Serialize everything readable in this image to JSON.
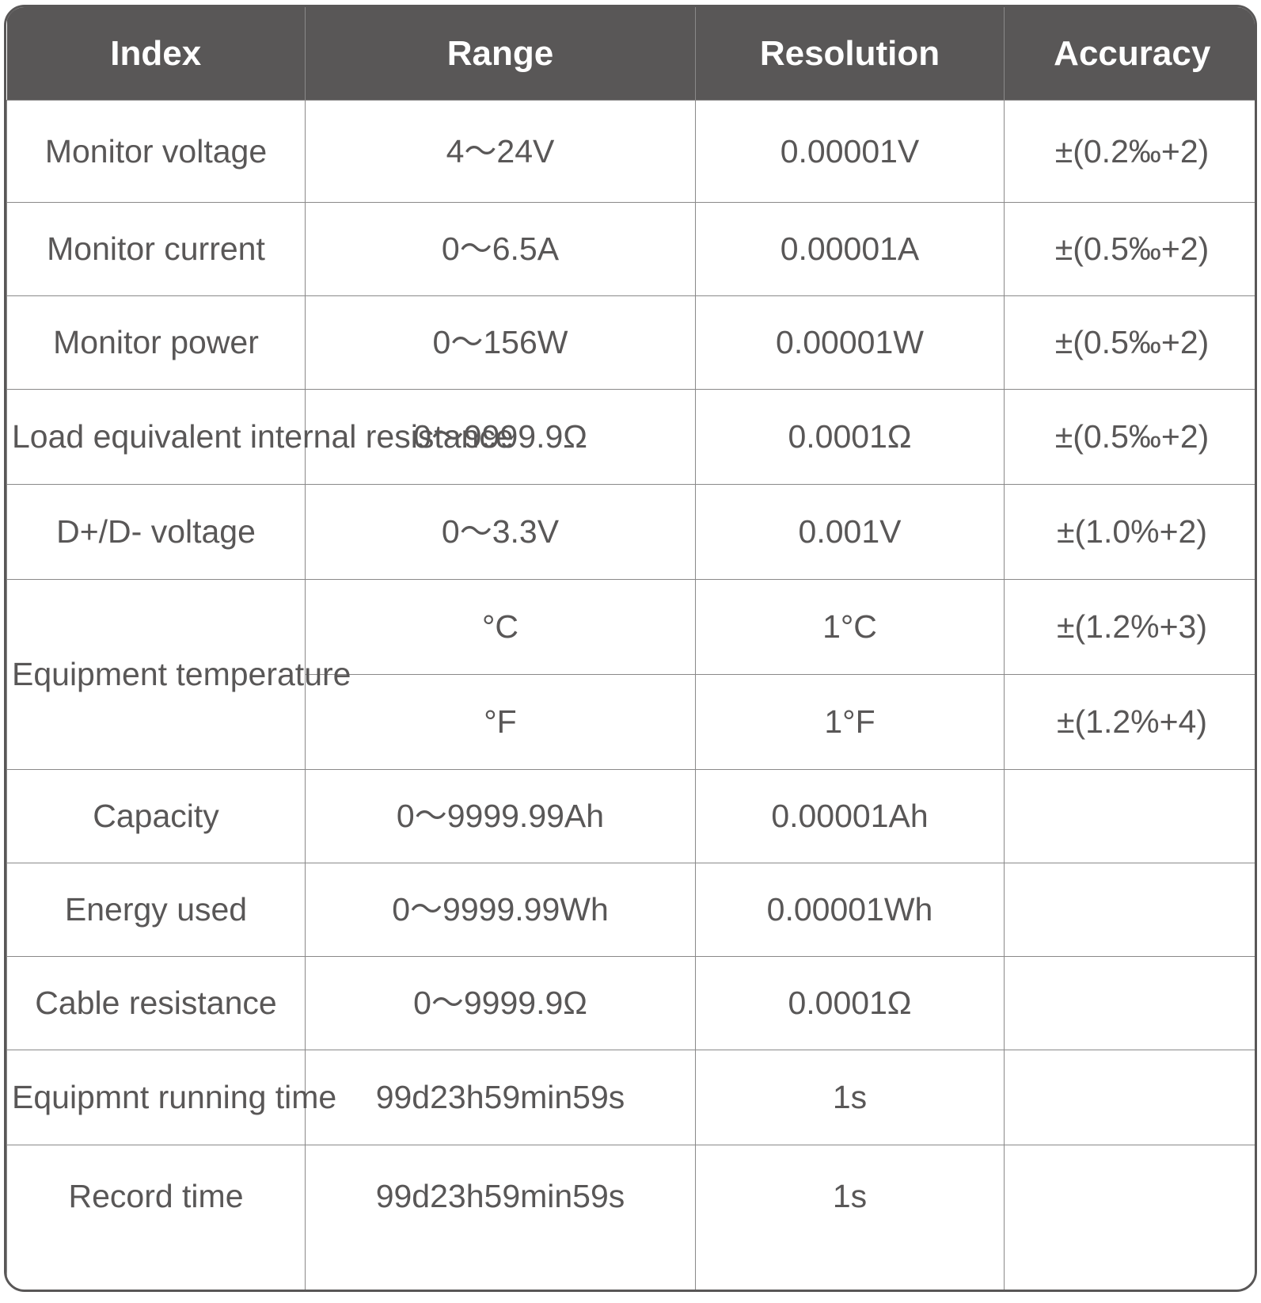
{
  "table": {
    "columns": [
      "Index",
      "Range",
      "Resolution",
      "Accuracy"
    ],
    "rows": [
      {
        "index": "Monitor voltage",
        "range": "4〜24V",
        "resolution": "0.00001V",
        "accuracy": "±(0.2‰+2)"
      },
      {
        "index": "Monitor current",
        "range": "0〜6.5A",
        "resolution": "0.00001A",
        "accuracy": "±(0.5‰+2)"
      },
      {
        "index": "Monitor power",
        "range": "0〜156W",
        "resolution": "0.00001W",
        "accuracy": "±(0.5‰+2)"
      },
      {
        "index": "Load equivalent internal resistance",
        "range": "0〜9999.9Ω",
        "resolution": "0.0001Ω",
        "accuracy": "±(0.5‰+2)"
      },
      {
        "index": "D+/D- voltage",
        "range": "0〜3.3V",
        "resolution": "0.001V",
        "accuracy": "±(1.0%+2)"
      },
      {
        "index": "Equipment temperature",
        "range": "°C",
        "resolution": "1°C",
        "accuracy": "±(1.2%+3)"
      },
      {
        "index": "",
        "range": "°F",
        "resolution": "1°F",
        "accuracy": "±(1.2%+4)"
      },
      {
        "index": "Capacity",
        "range": "0〜9999.99Ah",
        "resolution": "0.00001Ah",
        "accuracy": ""
      },
      {
        "index": "Energy used",
        "range": "0〜9999.99Wh",
        "resolution": "0.00001Wh",
        "accuracy": ""
      },
      {
        "index": "Cable resistance",
        "range": "0〜9999.9Ω",
        "resolution": "0.0001Ω",
        "accuracy": ""
      },
      {
        "index": "Equipmnt running time",
        "range": "99d23h59min59s",
        "resolution": "1s",
        "accuracy": ""
      },
      {
        "index": "Record time",
        "range": "99d23h59min59s",
        "resolution": "1s",
        "accuracy": ""
      }
    ]
  },
  "colors": {
    "header_background": "#595757",
    "header_text": "#ffffff",
    "body_text": "#595757",
    "grid_line": "#8a8989",
    "outer_border": "#595757",
    "cell_background": "#ffffff"
  }
}
